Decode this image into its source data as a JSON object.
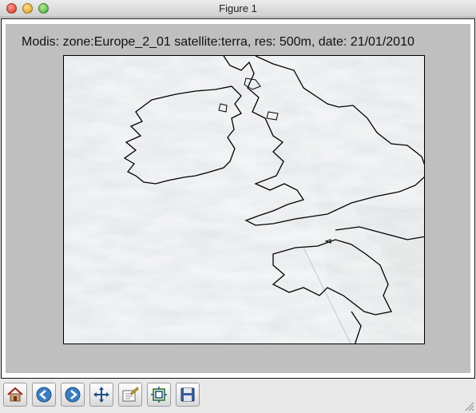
{
  "window": {
    "title": "Figure 1"
  },
  "figure": {
    "title": "Modis: zone:Europe_2_01 satellite:terra, res: 500m, date: 21/01/2010"
  },
  "toolbar": {
    "buttons": [
      {
        "name": "home",
        "icon": "home-icon"
      },
      {
        "name": "back",
        "icon": "back-arrow-icon"
      },
      {
        "name": "forward",
        "icon": "forward-arrow-icon"
      },
      {
        "name": "pan",
        "icon": "pan-move-icon"
      },
      {
        "name": "configure-subplots",
        "icon": "subplots-icon"
      },
      {
        "name": "zoom-to-rect",
        "icon": "zoom-rect-icon"
      },
      {
        "name": "save",
        "icon": "save-floppy-icon"
      }
    ]
  },
  "colors": {
    "figure_bg": "#bfbfbf",
    "coastline": "#000000",
    "cloud": "#e6e8ea"
  }
}
